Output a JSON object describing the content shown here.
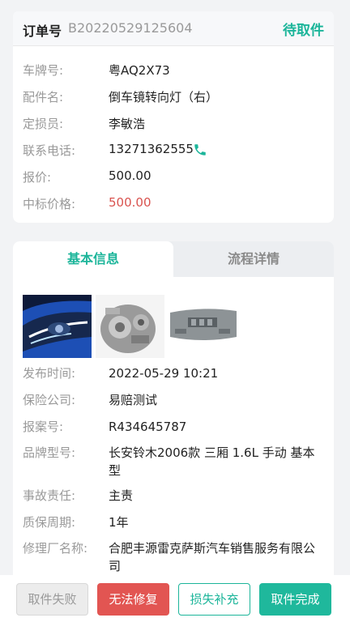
{
  "order": {
    "no_label": "订单号",
    "no": "B20220529125604",
    "status": "待取件"
  },
  "info": [
    {
      "label": "车牌号:",
      "value": "粤AQ2X73"
    },
    {
      "label": "配件名:",
      "value": "倒车镜转向灯（右）"
    },
    {
      "label": "定损员:",
      "value": "李敏浩"
    },
    {
      "label": "联系电话:",
      "value": "13271362555"
    },
    {
      "label": "报价:",
      "value": "500.00"
    },
    {
      "label": "中标价格:",
      "value": "500.00"
    }
  ],
  "tabs": {
    "basic": "基本信息",
    "process": "流程详情"
  },
  "details": [
    {
      "label": "发布时间:",
      "value": "2022-05-29 10:21"
    },
    {
      "label": "保险公司:",
      "value": "易赔测试"
    },
    {
      "label": "报案号:",
      "value": "R434645787"
    },
    {
      "label": "品牌型号:",
      "value": "长安铃木2006款 三厢 1.6L 手动 基本型"
    },
    {
      "label": "事故责任:",
      "value": "主责"
    },
    {
      "label": "质保周期:",
      "value": "1年"
    },
    {
      "label": "修理厂名称:",
      "value": "合肥丰源雷克萨斯汽车销售服务有限公司"
    }
  ],
  "buttons": {
    "fail": "取件失败",
    "unrepairable": "无法修复",
    "supplement": "损失补充",
    "complete": "取件完成"
  },
  "colors": {
    "accent": "#1cb59a",
    "danger": "#e25552",
    "price_red": "#d9534f"
  }
}
